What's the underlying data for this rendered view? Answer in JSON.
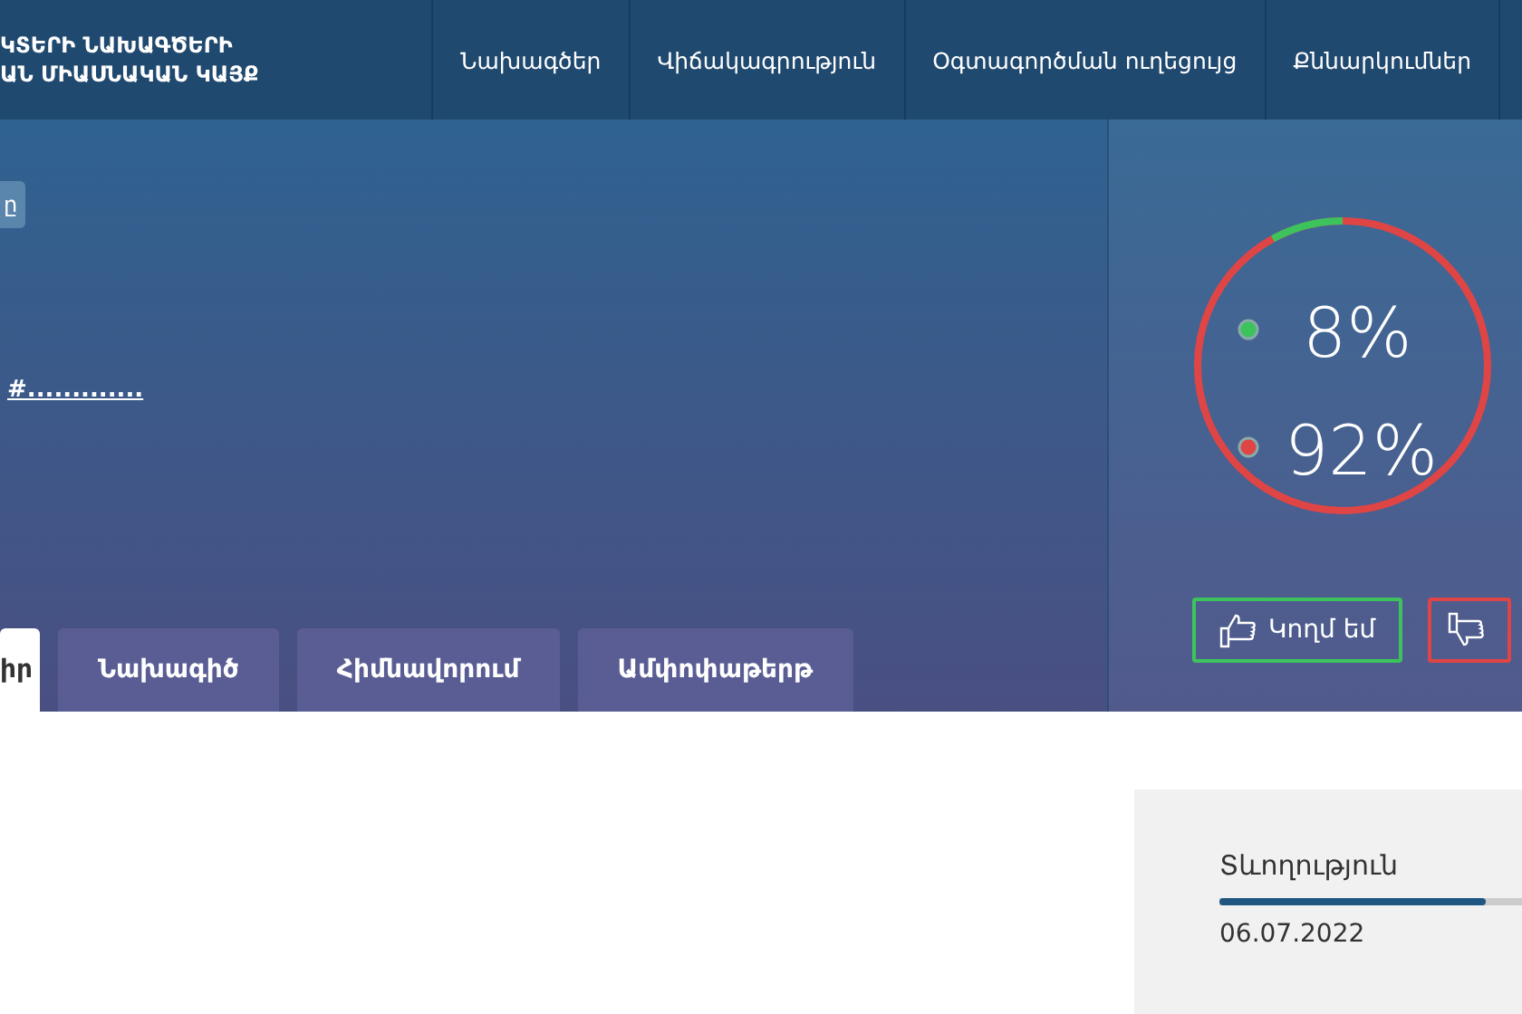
{
  "header": {
    "logo_lines": [
      "ԿՏԵՐԻ ՆԱԽԱԳԾԵՐԻ",
      "ԱՆ ՄԻԱՍՆԱԿԱՆ ԿԱՅՔ"
    ],
    "nav": [
      {
        "label": "Նախագծեր"
      },
      {
        "label": "Վիճակագրություն"
      },
      {
        "label": "Օգտագործման ուղեցույց"
      },
      {
        "label": "Քննարկումներ"
      }
    ]
  },
  "hero": {
    "tag": "ը",
    "link": "#.............",
    "tabs": [
      {
        "label": "իր",
        "selected": true
      },
      {
        "label": "Նախագիծ",
        "selected": false
      },
      {
        "label": "Հիմնավորում",
        "selected": false
      },
      {
        "label": "Ամփոփաթերթ",
        "selected": false
      }
    ]
  },
  "vote": {
    "level": 0.08,
    "for_percent": "8%",
    "against_percent": "92%",
    "for_button": "Կողմ եմ"
  },
  "duration": {
    "label": "Տևողություն",
    "level": 0.88,
    "date": "06.07.2022"
  }
}
